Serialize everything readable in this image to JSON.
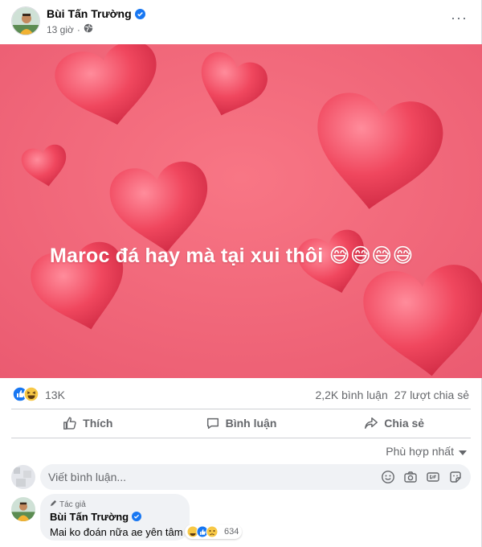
{
  "post": {
    "author": "Bùi Tấn Trường",
    "time": "13 giờ",
    "more_label": "···",
    "caption": "Maroc đá hay mà tại xui thôi",
    "caption_emoji": "😅😅😅😅",
    "image_bg_color": "#f06379",
    "heart_color": "#ee3d57"
  },
  "reactions": {
    "count": "13K",
    "icons": [
      "like-icon",
      "haha-icon"
    ]
  },
  "engagement": {
    "comments": "2,2K bình luận",
    "shares": "27 lượt chia sẻ"
  },
  "actions": {
    "like": "Thích",
    "comment": "Bình luận",
    "share": "Chia sẻ"
  },
  "sort": {
    "label": "Phù hợp nhất"
  },
  "composer": {
    "placeholder": "Viết bình luận...",
    "icons": [
      "emoji-icon",
      "camera-icon",
      "gif-icon",
      "sticker-icon"
    ]
  },
  "comment": {
    "badge": "Tác giả",
    "author": "Bùi Tấn Trường",
    "text": "Mai ko đoán nữa ae yên tâm",
    "reaction_count": "634"
  },
  "colors": {
    "accent": "#1877f2",
    "muted_text": "#65676b"
  }
}
